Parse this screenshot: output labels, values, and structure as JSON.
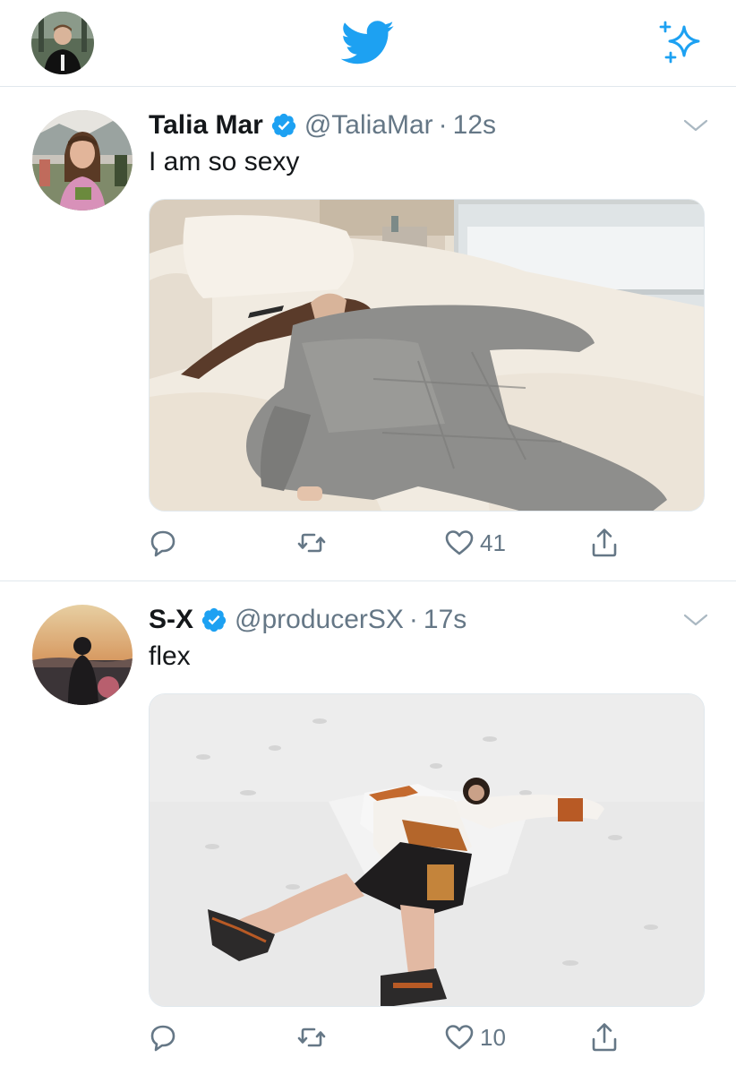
{
  "header": {
    "profile_avatar": "profile-avatar",
    "logo": "twitter-bird-icon",
    "sparkle": "sparkle-icon"
  },
  "colors": {
    "brand_blue": "#1da1f2",
    "text_primary": "#14171a",
    "text_secondary": "#657786",
    "divider": "#e1e8ed"
  },
  "tweets": [
    {
      "name": "Talia Mar",
      "verified": true,
      "handle": "@TaliaMar",
      "separator": "·",
      "time": "12s",
      "text": "I am so sexy",
      "media": "photo",
      "likes": "41"
    },
    {
      "name": "S-X",
      "verified": true,
      "handle": "@producerSX",
      "separator": "·",
      "time": "17s",
      "text": "flex",
      "media": "photo",
      "likes": "10"
    }
  ]
}
